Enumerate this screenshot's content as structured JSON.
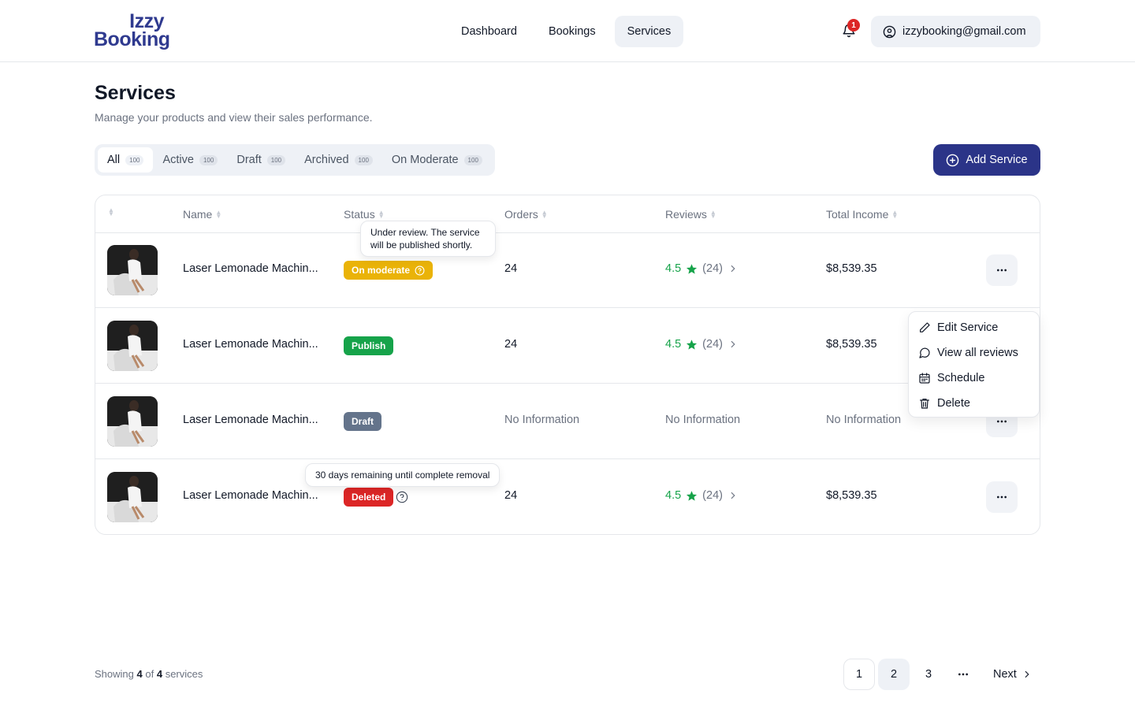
{
  "brand": {
    "line1": "Izzy",
    "line2": "Booking",
    "color": "#2f3a8f"
  },
  "nav": {
    "items": [
      "Dashboard",
      "Bookings",
      "Services"
    ],
    "active": "Services"
  },
  "notifications": {
    "count": "1"
  },
  "account": {
    "email": "izzybooking@gmail.com"
  },
  "page": {
    "title": "Services",
    "subtitle": "Manage your products and view their sales performance."
  },
  "tabs": [
    {
      "label": "All",
      "count": "100"
    },
    {
      "label": "Active",
      "count": "100"
    },
    {
      "label": "Draft",
      "count": "100"
    },
    {
      "label": "Archived",
      "count": "100"
    },
    {
      "label": "On Moderate",
      "count": "100"
    }
  ],
  "add_button": {
    "label": "Add Service",
    "color": "#2b3488"
  },
  "table": {
    "columns": [
      "Name",
      "Status",
      "Orders",
      "Reviews",
      "Total Income"
    ],
    "rows": [
      {
        "name": "Laser Lemonade Machin...",
        "status": "On moderate",
        "orders": "24",
        "rating": "4.5",
        "reviews": "(24)",
        "income": "$8,539.35"
      },
      {
        "name": "Laser Lemonade Machin...",
        "status": "Publish",
        "orders": "24",
        "rating": "4.5",
        "reviews": "(24)",
        "income": "$8,539.35"
      },
      {
        "name": "Laser Lemonade Machin...",
        "status": "Draft",
        "orders": "No Information",
        "rating": "No Information",
        "income": "No Information"
      },
      {
        "name": "Laser Lemonade Machin...",
        "status": "Deleted",
        "orders": "24",
        "rating": "4.5",
        "reviews": "(24)",
        "income": "$8,539.35"
      }
    ]
  },
  "tooltips": {
    "moderate_line1": "Under review. The service",
    "moderate_line2": "will be published shortly.",
    "deleted": "30 days remaining until complete removal"
  },
  "row_menu": [
    "Edit Service",
    "View all reviews",
    "Schedule",
    "Delete"
  ],
  "footer": {
    "showing_prefix": "Showing",
    "showing_count": "4",
    "showing_of": "of",
    "showing_total": "4",
    "showing_suffix": "services"
  },
  "pagination": {
    "pages": [
      "1",
      "2",
      "3"
    ],
    "active": "2",
    "ellipsis": "...",
    "next": "Next"
  },
  "colors": {
    "moderate": "#eab308",
    "publish": "#16a34a",
    "draft": "#64748b",
    "deleted": "#dc2626",
    "rating": "#16a34a"
  }
}
